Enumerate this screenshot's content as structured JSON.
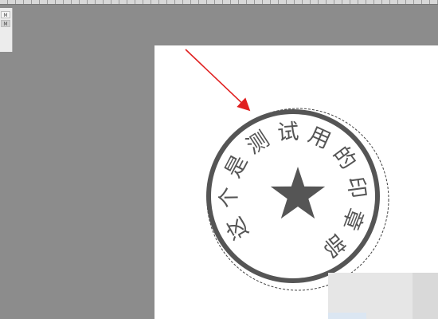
{
  "panel": {
    "button_1": "M",
    "button_2": "M"
  },
  "stamp": {
    "text": "这个是测试用的印章部",
    "chars": [
      "这",
      "个",
      "是",
      "测",
      "试",
      "用",
      "的",
      "印",
      "章",
      "部"
    ],
    "color": "#555555",
    "icon": "star-icon"
  },
  "colors": {
    "workspace": "#8c8c8c",
    "canvas": "#ffffff",
    "arrow": "#e02020"
  }
}
